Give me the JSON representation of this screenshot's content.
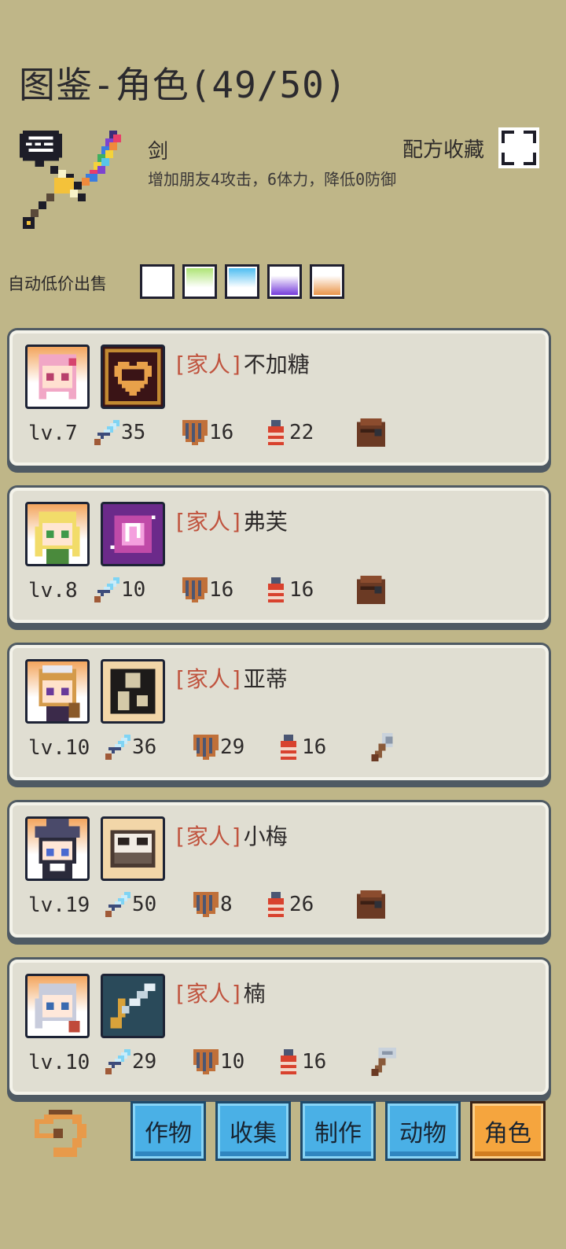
{
  "page_title": "图鉴-角色(49/50)",
  "item": {
    "name": "剑",
    "description": "增加朋友4攻击，6体力，降低0防御",
    "icon": "rainbow-sword-icon"
  },
  "recipe_label": "配方收藏",
  "auto_sell": {
    "label": "自动低价出售",
    "swatches": [
      {
        "name": "white",
        "colors": [
          "#ffffff",
          "#ffffff"
        ]
      },
      {
        "name": "green",
        "colors": [
          "#ffffff",
          "#a8e26a"
        ]
      },
      {
        "name": "blue",
        "colors": [
          "#ffffff",
          "#40b8f0"
        ]
      },
      {
        "name": "purple",
        "colors": [
          "#ffffff",
          "#6a2bd8"
        ]
      },
      {
        "name": "orange",
        "colors": [
          "#ffffff",
          "#e88c3a"
        ]
      }
    ]
  },
  "characters": [
    {
      "tag": "[家人]",
      "name": "不加糖",
      "level": "lv.7",
      "attack": "35",
      "defense": "16",
      "stamina": "22",
      "tool": "backpack-icon",
      "portrait": "pink-hair-girl",
      "item": "heart-frame"
    },
    {
      "tag": "[家人]",
      "name": "弗芙",
      "level": "lv.8",
      "attack": "10",
      "defense": "16",
      "stamina": "16",
      "tool": "backpack-icon",
      "portrait": "blonde-girl",
      "item": "music-notes"
    },
    {
      "tag": "[家人]",
      "name": "亚蒂",
      "level": "lv.10",
      "attack": "36",
      "defense": "29",
      "stamina": "16",
      "tool": "axe-icon",
      "portrait": "brown-hair-maid",
      "item": "shadow-silhouette"
    },
    {
      "tag": "[家人]",
      "name": "小梅",
      "level": "lv.19",
      "attack": "50",
      "defense": "8",
      "stamina": "26",
      "tool": "backpack-icon",
      "portrait": "witch-girl",
      "item": "panda-ball"
    },
    {
      "tag": "[家人]",
      "name": "楠",
      "level": "lv.10",
      "attack": "29",
      "defense": "10",
      "stamina": "16",
      "tool": "hammer-icon",
      "portrait": "silver-hair-girl",
      "item": "sword"
    }
  ],
  "tabs": [
    {
      "label": "作物",
      "active": false
    },
    {
      "label": "收集",
      "active": false
    },
    {
      "label": "制作",
      "active": false
    },
    {
      "label": "动物",
      "active": false
    },
    {
      "label": "角色",
      "active": true
    }
  ],
  "colors": {
    "background": "#bfb688",
    "tab_blue": "#4ab0e6",
    "tab_active": "#f5a53e",
    "tag_red": "#c0533e"
  }
}
